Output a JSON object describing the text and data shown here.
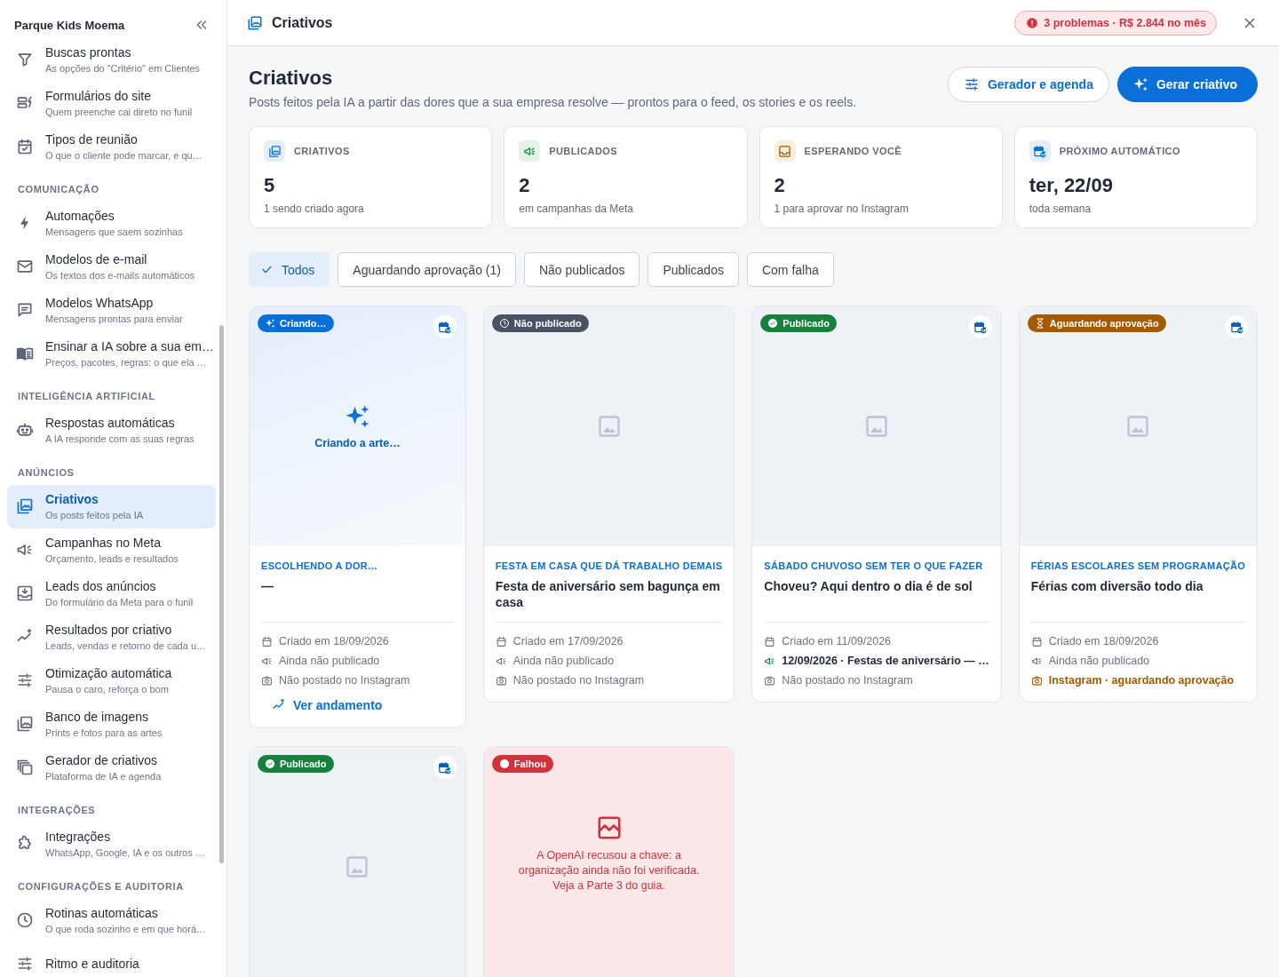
{
  "sidebar": {
    "workspace": "Parque Kids Moema",
    "sections": [
      {
        "items": [
          {
            "title": "Buscas prontas",
            "subtitle": "As opções do \"Critério\" em Clientes",
            "selected": false
          },
          {
            "title": "Formulários do site",
            "subtitle": "Quem preenche cai direto no funil",
            "selected": false
          },
          {
            "title": "Tipos de reunião",
            "subtitle": "O que o cliente pode marcar, e qu…",
            "selected": false
          }
        ]
      },
      {
        "heading": "COMUNICAÇÃO",
        "items": [
          {
            "title": "Automações",
            "subtitle": "Mensagens que saem sozinhas",
            "selected": false
          },
          {
            "title": "Modelos de e-mail",
            "subtitle": "Os textos dos e-mails automáticos",
            "selected": false
          },
          {
            "title": "Modelos WhatsApp",
            "subtitle": "Mensagens prontas para enviar",
            "selected": false
          },
          {
            "title": "Ensinar a IA sobre a sua em…",
            "subtitle": "Preços, pacotes, regras: o que ela …",
            "selected": false
          }
        ]
      },
      {
        "heading": "INTELIGÊNCIA ARTIFICIAL",
        "items": [
          {
            "title": "Respostas automáticas",
            "subtitle": "A IA responde com as suas regras",
            "selected": false
          }
        ]
      },
      {
        "heading": "ANÚNCIOS",
        "items": [
          {
            "title": "Criativos",
            "subtitle": "Os posts feitos pela IA",
            "selected": true
          },
          {
            "title": "Campanhas no Meta",
            "subtitle": "Orçamento, leads e resultados",
            "selected": false
          },
          {
            "title": "Leads dos anúncios",
            "subtitle": "Do formulário da Meta para o funil",
            "selected": false
          },
          {
            "title": "Resultados por criativo",
            "subtitle": "Leads, vendas e retorno de cada u…",
            "selected": false
          },
          {
            "title": "Otimização automática",
            "subtitle": "Pausa o caro, reforça o bom",
            "selected": false
          },
          {
            "title": "Banco de imagens",
            "subtitle": "Prints e fotos para as artes",
            "selected": false
          },
          {
            "title": "Gerador de criativos",
            "subtitle": "Plataforma de IA e agenda",
            "selected": false
          }
        ]
      },
      {
        "heading": "INTEGRAÇÕES",
        "items": [
          {
            "title": "Integrações",
            "subtitle": "WhatsApp, Google, IA e os outros …",
            "selected": false
          }
        ]
      },
      {
        "heading": "CONFIGURAÇÕES E AUDITORIA",
        "items": [
          {
            "title": "Rotinas automáticas",
            "subtitle": "O que roda sozinho e em que horá…",
            "selected": false
          },
          {
            "title": "Ritmo e auditoria",
            "selected": false
          }
        ]
      }
    ]
  },
  "top_bar": {
    "title": "Criativos",
    "alert": "3 problemas · R$ 2.844 no mês"
  },
  "header": {
    "title": "Criativos",
    "subtitle": "Posts feitos pela IA a partir das dores que a sua empresa resolve — prontos para o feed, os stories e os reels.",
    "buttons": [
      {
        "label": "Gerador e agenda",
        "kind": "secondary"
      },
      {
        "label": "Gerar criativo",
        "kind": "primary"
      }
    ]
  },
  "stats": [
    {
      "kind": "creatives",
      "label": "CRIATIVOS",
      "value": "5",
      "note": "1 sendo criado agora"
    },
    {
      "kind": "published",
      "label": "PUBLICADOS",
      "value": "2",
      "note": "em campanhas da Meta"
    },
    {
      "kind": "waiting",
      "label": "ESPERANDO VOCÊ",
      "value": "2",
      "note": "1 para aprovar no Instagram"
    },
    {
      "kind": "next",
      "label": "PRÓXIMO AUTOMÁTICO",
      "value": "ter, 22/09",
      "note": "toda semana"
    }
  ],
  "filters": [
    {
      "label": "Todos",
      "selected": true
    },
    {
      "label": "Aguardando aprovação (1)",
      "selected": false
    },
    {
      "label": "Não publicados",
      "selected": false
    },
    {
      "label": "Publicados",
      "selected": false
    },
    {
      "label": "Com falha",
      "selected": false
    }
  ],
  "cards": [
    {
      "kind": "creating",
      "badge": "Criando…",
      "schedule_button": true,
      "preview": {
        "kind": "creating",
        "text": "Criando a arte…"
      },
      "topic": "ESCOLHENDO A DOR…",
      "title": "—",
      "meta": [
        {
          "kind": "date",
          "text": "Criado em 18/09/2026"
        },
        {
          "kind": "campaign",
          "text": "Ainda não publicado"
        },
        {
          "kind": "instagram",
          "text": "Não postado no Instagram"
        }
      ],
      "link": "Ver andamento"
    },
    {
      "kind": "unpublished",
      "badge": "Não publicado",
      "schedule_button": false,
      "preview": {
        "kind": "placeholder"
      },
      "topic": "FESTA EM CASA QUE DÁ TRABALHO DEMAIS",
      "title": "Festa de aniversário sem bagunça em casa",
      "meta": [
        {
          "kind": "date",
          "text": "Criado em 17/09/2026"
        },
        {
          "kind": "campaign",
          "text": "Ainda não publicado"
        },
        {
          "kind": "instagram",
          "text": "Não postado no Instagram"
        }
      ]
    },
    {
      "kind": "published",
      "badge": "Publicado",
      "schedule_button": true,
      "preview": {
        "kind": "placeholder"
      },
      "topic": "SÁBADO CHUVOSO SEM TER O QUE FAZER",
      "title": "Choveu? Aqui dentro o dia é de sol",
      "meta": [
        {
          "kind": "date",
          "text": "Criado em 11/09/2026"
        },
        {
          "kind": "campaign_live",
          "text": "12/09/2026 · Festas de aniversário — …"
        },
        {
          "kind": "instagram",
          "text": "Não postado no Instagram"
        }
      ]
    },
    {
      "kind": "awaiting",
      "badge": "Aguardando aprovação",
      "schedule_button": true,
      "preview": {
        "kind": "placeholder"
      },
      "topic": "FÉRIAS ESCOLARES SEM PROGRAMAÇÃO",
      "title": "Férias com diversão todo dia",
      "meta": [
        {
          "kind": "date",
          "text": "Criado em 18/09/2026"
        },
        {
          "kind": "campaign",
          "text": "Ainda não publicado"
        },
        {
          "kind": "instagram_pending",
          "text": "Instagram · aguardando aprovação"
        }
      ]
    },
    {
      "kind": "published",
      "badge": "Publicado",
      "schedule_button": true,
      "preview": {
        "kind": "placeholder"
      }
    },
    {
      "kind": "failed",
      "badge": "Falhou",
      "schedule_button": false,
      "preview": {
        "kind": "error",
        "text": "A OpenAI recusou a chave: a organização ainda não foi verificada. Veja a Parte 3 do guia."
      }
    }
  ]
}
